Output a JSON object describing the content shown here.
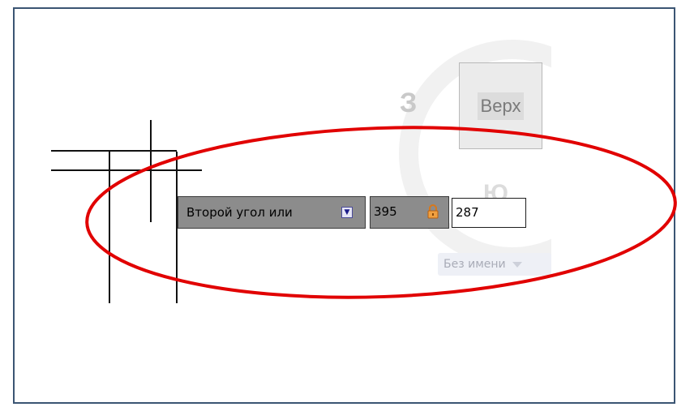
{
  "viewcube": {
    "face_label": "Верх",
    "compass_west": "З",
    "compass_south": "Ю"
  },
  "dynamic_input": {
    "prompt": "Второй угол или",
    "x_value": "395",
    "y_value": "287"
  },
  "ucs": {
    "label": "Без имени"
  },
  "colors": {
    "frame_border": "#3b5573",
    "highlight": "#e10000",
    "prompt_bg": "#8c8c8c"
  },
  "icons": {
    "prompt_options": "down-arrow-icon",
    "lock": "lock-icon",
    "ucs_menu": "chevron-down-icon"
  }
}
